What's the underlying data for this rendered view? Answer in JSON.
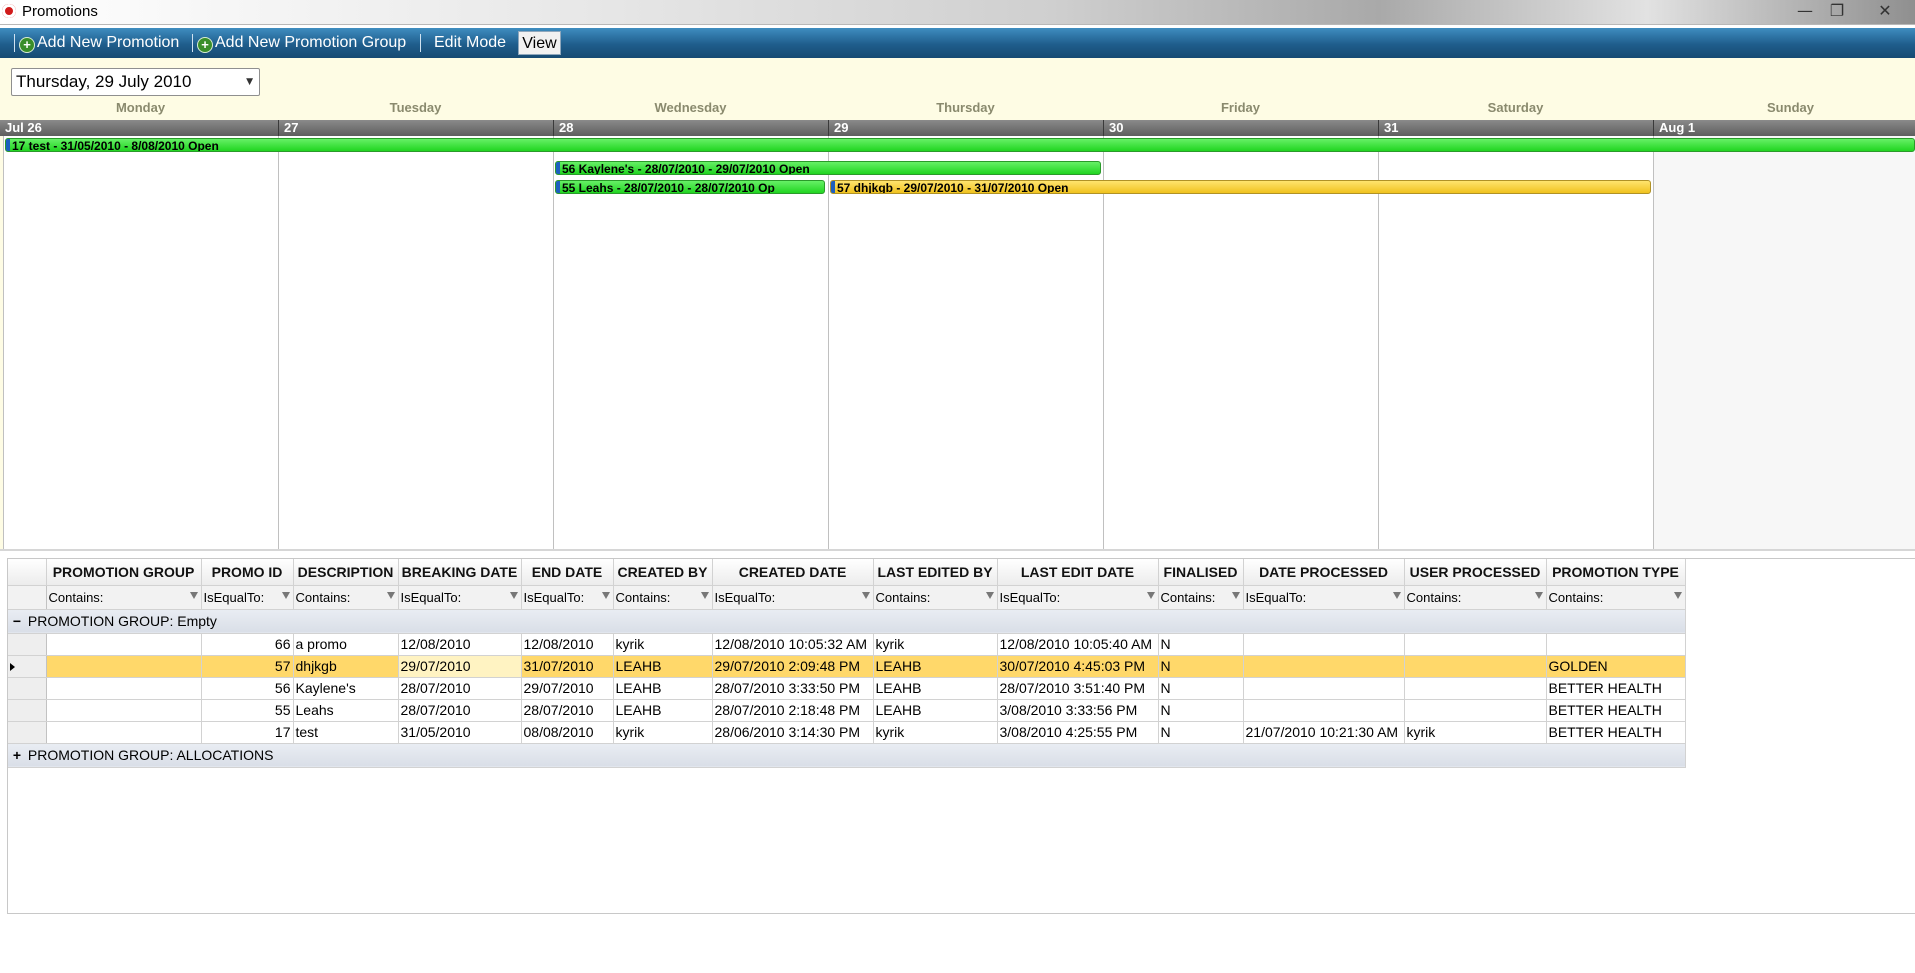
{
  "window": {
    "title": "Promotions",
    "minimize_glyph": "—",
    "restore_glyph": "❐",
    "close_glyph": "✕"
  },
  "toolbar": {
    "add_promotion": "Add New Promotion",
    "add_promotion_group": "Add New Promotion Group",
    "edit_mode": "Edit Mode",
    "view": "View"
  },
  "scheduler": {
    "date_picker_value": "Thursday, 29 July 2010",
    "days": [
      "Monday",
      "Tuesday",
      "Wednesday",
      "Thursday",
      "Friday",
      "Saturday",
      "Sunday"
    ],
    "dates": [
      "Jul 26",
      "27",
      "28",
      "29",
      "30",
      "31",
      "Aug 1"
    ],
    "appointments": [
      {
        "label": "17 test - 31/05/2010 - 8/08/2010 Open",
        "color": "#21d521"
      },
      {
        "label": "56 Kaylene's - 28/07/2010 - 29/07/2010 Open",
        "color": "#21d521"
      },
      {
        "label": "55 Leahs - 28/07/2010 - 28/07/2010 Op",
        "color": "#21d521"
      },
      {
        "label": "57 dhjkgb - 29/07/2010 - 31/07/2010 Open",
        "color": "#f0c21e"
      }
    ]
  },
  "grid": {
    "headers": [
      "PROMOTION GROUP",
      "PROMO ID",
      "DESCRIPTION",
      "BREAKING DATE",
      "END DATE",
      "CREATED BY",
      "CREATED DATE",
      "LAST EDITED BY",
      "LAST EDIT DATE",
      "FINALISED",
      "DATE PROCESSED",
      "USER PROCESSED",
      "PROMOTION TYPE"
    ],
    "filters": [
      "Contains:",
      "IsEqualTo:",
      "Contains:",
      "IsEqualTo:",
      "IsEqualTo:",
      "Contains:",
      "IsEqualTo:",
      "Contains:",
      "IsEqualTo:",
      "Contains:",
      "IsEqualTo:",
      "Contains:",
      "Contains:"
    ],
    "group_empty": {
      "toggle": "−",
      "label": "PROMOTION GROUP: Empty"
    },
    "rows": [
      [
        "",
        "66",
        "a promo",
        "12/08/2010",
        "12/08/2010",
        "kyrik",
        "12/08/2010 10:05:32 AM",
        "kyrik",
        "12/08/2010 10:05:40 AM",
        "N",
        "",
        "",
        ""
      ],
      [
        "",
        "57",
        "dhjkgb",
        "29/07/2010",
        "31/07/2010",
        "LEAHB",
        "29/07/2010 2:09:48 PM",
        "LEAHB",
        "30/07/2010 4:45:03 PM",
        "N",
        "",
        "",
        "GOLDEN"
      ],
      [
        "",
        "56",
        "Kaylene's",
        "28/07/2010",
        "29/07/2010",
        "LEAHB",
        "28/07/2010 3:33:50 PM",
        "LEAHB",
        "28/07/2010 3:51:40 PM",
        "N",
        "",
        "",
        "BETTER HEALTH"
      ],
      [
        "",
        "55",
        "Leahs",
        "28/07/2010",
        "28/07/2010",
        "LEAHB",
        "28/07/2010 2:18:48 PM",
        "LEAHB",
        "3/08/2010 3:33:56 PM",
        "N",
        "",
        "",
        "BETTER HEALTH"
      ],
      [
        "",
        "17",
        "test",
        "31/05/2010",
        "08/08/2010",
        "kyrik",
        "28/06/2010 3:14:30 PM",
        "kyrik",
        "3/08/2010 4:25:55 PM",
        "N",
        "21/07/2010 10:21:30 AM",
        "kyrik",
        "BETTER HEALTH"
      ]
    ],
    "selected_row": 1,
    "group_allocations": {
      "toggle": "+",
      "label": "PROMOTION GROUP: ALLOCATIONS"
    },
    "selection_color": "#ffd86a"
  }
}
